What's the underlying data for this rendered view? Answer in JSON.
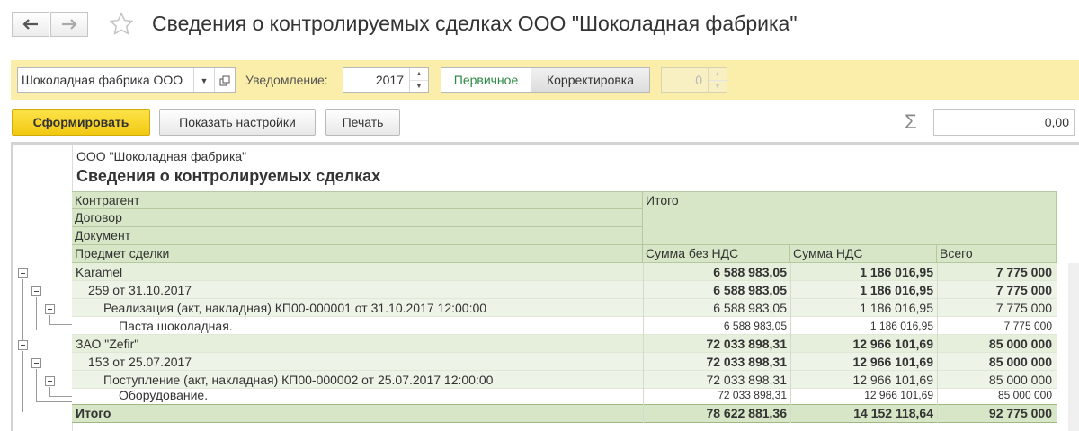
{
  "window": {
    "title": "Сведения о контролируемых сделках ООО \"Шоколадная фабрика\""
  },
  "toolbar": {
    "organization": "Шоколадная фабрика ООО",
    "notice_label": "Уведомление:",
    "year": "2017",
    "primary_label": "Первичное",
    "correction_label": "Корректировка",
    "correction_number": "0"
  },
  "actions": {
    "generate": "Сформировать",
    "show_settings": "Показать настройки",
    "print": "Печать",
    "sum_value": "0,00"
  },
  "report": {
    "org": "ООО \"Шоколадная фабрика\"",
    "title": "Сведения о контролируемых сделках",
    "headers": {
      "counterparty": "Контрагент",
      "contract": "Договор",
      "document": "Документ",
      "subject": "Предмет сделки",
      "total_group": "Итого",
      "sum_no_vat": "Сумма без НДС",
      "vat": "Сумма НДС",
      "all": "Всего"
    },
    "rows": [
      {
        "label": "Karamel",
        "sum": "6 588 983,05",
        "vat": "1 186 016,95",
        "total": "7 775 000"
      },
      {
        "label": "259 от 31.10.2017",
        "sum": "6 588 983,05",
        "vat": "1 186 016,95",
        "total": "7 775 000"
      },
      {
        "label": "Реализация (акт, накладная) КП00-000001 от 31.10.2017 12:00:00",
        "sum": "6 588 983,05",
        "vat": "1 186 016,95",
        "total": "7 775 000"
      },
      {
        "label": "Паста шоколадная.",
        "sum": "6 588 983,05",
        "vat": "1 186 016,95",
        "total": "7 775 000"
      },
      {
        "label": "ЗАО \"Zefir\"",
        "sum": "72 033 898,31",
        "vat": "12 966 101,69",
        "total": "85 000 000"
      },
      {
        "label": "153 от 25.07.2017",
        "sum": "72 033 898,31",
        "vat": "12 966 101,69",
        "total": "85 000 000"
      },
      {
        "label": "Поступление (акт, накладная) КП00-000002 от 25.07.2017 12:00:00",
        "sum": "72 033 898,31",
        "vat": "12 966 101,69",
        "total": "85 000 000"
      },
      {
        "label": "Оборудование.",
        "sum": "72 033 898,31",
        "vat": "12 966 101,69",
        "total": "85 000 000"
      }
    ],
    "grand_total": {
      "label": "Итого",
      "sum": "78 622 881,36",
      "vat": "14 152 118,64",
      "total": "92 775 000"
    }
  }
}
